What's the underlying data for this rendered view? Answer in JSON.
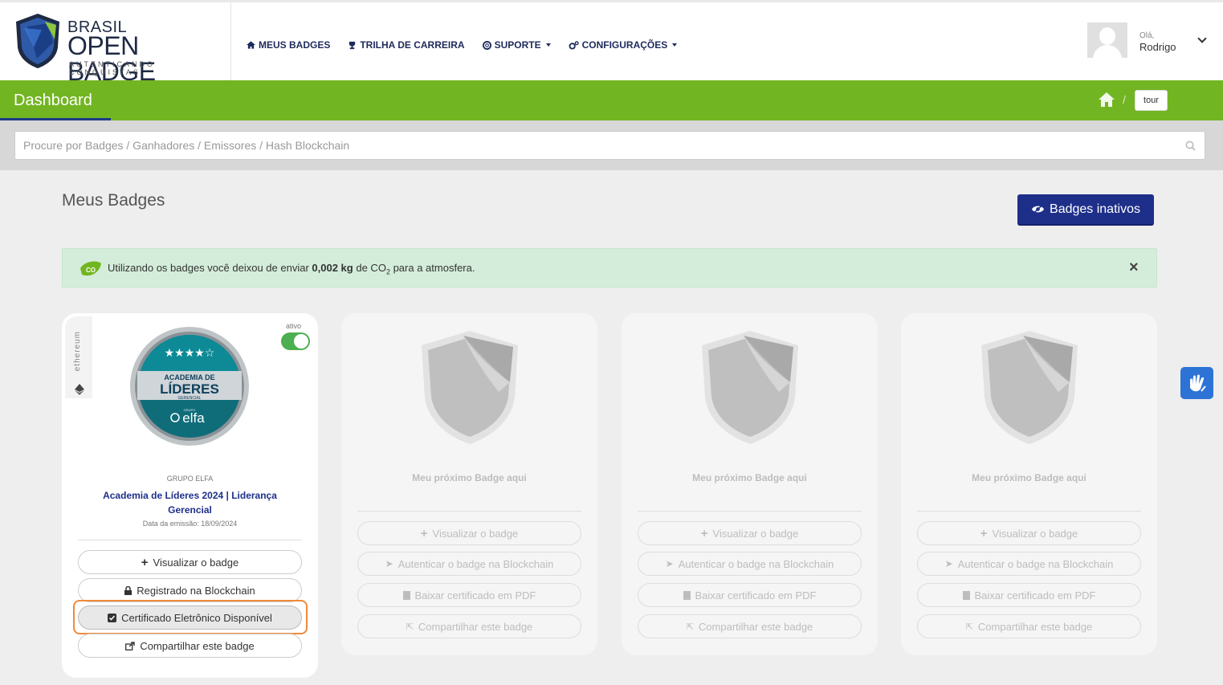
{
  "header": {
    "logo": {
      "line1": "BRASIL",
      "line2": "OPEN BADGE",
      "tagline": "AUTENTICANDO CONQUISTAS"
    },
    "nav": [
      {
        "label": "MEUS BADGES",
        "icon": "home-icon",
        "dropdown": false
      },
      {
        "label": "TRILHA DE CARREIRA",
        "icon": "trophy-icon",
        "dropdown": false
      },
      {
        "label": "SUPORTE",
        "icon": "lifebuoy-icon",
        "dropdown": true
      },
      {
        "label": "CONFIGURAÇÕES",
        "icon": "gears-icon",
        "dropdown": true
      }
    ],
    "user": {
      "greeting": "Olá,",
      "name": "Rodrigo"
    }
  },
  "greenbar": {
    "title": "Dashboard",
    "breadcrumb_sep": "/",
    "tour_label": "tour"
  },
  "search": {
    "placeholder": "Procure por Badges / Ganhadores / Emissores / Hash Blockchain"
  },
  "main": {
    "section_title": "Meus Badges",
    "inactive_button": "Badges inativos",
    "alert": {
      "prefix": "Utilizando os badges você deixou de enviar",
      "amount": "0,002 kg",
      "middle": "de CO",
      "subscript": "2",
      "suffix": "para a atmosfera.",
      "close": "×",
      "icon_label": "CO"
    }
  },
  "cards": [
    {
      "chain_label": "ethereum",
      "status_label": "ativo",
      "active": true,
      "badge_lines": [
        "ACADEMIA DE",
        "LÍDERES",
        "GERENCIAL",
        "GRUPO",
        "elfa"
      ],
      "issuer": "GRUPO ELFA",
      "title": "Academia de Líderes 2024 | Liderança Gerencial",
      "date": "Data da emissão: 18/09/2024",
      "buttons": [
        {
          "label": "Visualizar o badge",
          "icon": "plus-icon"
        },
        {
          "label": "Registrado na Blockchain",
          "icon": "lock-icon"
        },
        {
          "label": "Certificado Eletrônico Disponível",
          "icon": "checkbox-icon"
        },
        {
          "label": "Compartilhar este badge",
          "icon": "share-icon"
        }
      ]
    },
    {
      "placeholder": "Meu próximo Badge aqui",
      "buttons": [
        {
          "label": "Visualizar o badge",
          "icon": "plus-icon"
        },
        {
          "label": "Autenticar o badge na Blockchain",
          "icon": "send-icon"
        },
        {
          "label": "Baixar certificado em PDF",
          "icon": "file-icon"
        },
        {
          "label": "Compartilhar este badge",
          "icon": "share-icon"
        }
      ]
    },
    {
      "placeholder": "Meu próximo Badge aqui",
      "buttons": [
        {
          "label": "Visualizar o badge",
          "icon": "plus-icon"
        },
        {
          "label": "Autenticar o badge na Blockchain",
          "icon": "send-icon"
        },
        {
          "label": "Baixar certificado em PDF",
          "icon": "file-icon"
        },
        {
          "label": "Compartilhar este badge",
          "icon": "share-icon"
        }
      ]
    },
    {
      "placeholder": "Meu próximo Badge aqui",
      "buttons": [
        {
          "label": "Visualizar o badge",
          "icon": "plus-icon"
        },
        {
          "label": "Autenticar o badge na Blockchain",
          "icon": "send-icon"
        },
        {
          "label": "Baixar certificado em PDF",
          "icon": "file-icon"
        },
        {
          "label": "Compartilhar este badge",
          "icon": "share-icon"
        }
      ]
    }
  ],
  "colors": {
    "brand_navy": "#1e2f8a",
    "brand_green": "#72b522",
    "alert_bg": "#d4edda",
    "highlight": "#f08a3c"
  }
}
